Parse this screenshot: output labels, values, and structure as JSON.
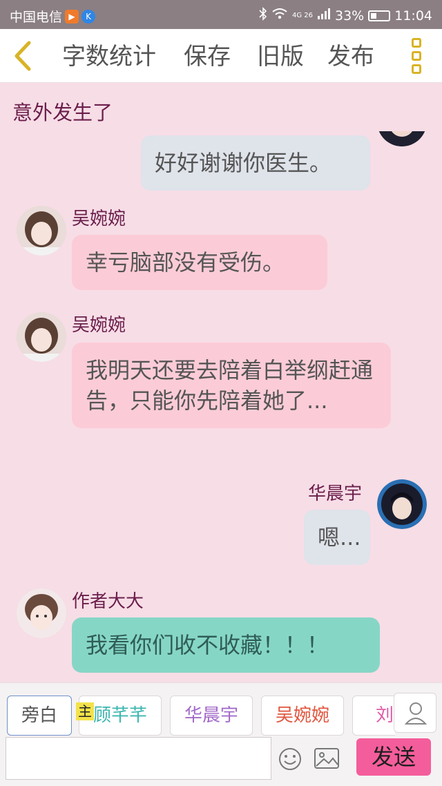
{
  "status_bar": {
    "carrier": "中国电信",
    "network": "4G 26",
    "battery_percent": "33%",
    "battery_level": 0.33,
    "time": "11:04"
  },
  "toolbar": {
    "back_icon": "chevron-left-icon",
    "word_count_label": "字数统计",
    "save_label": "保存",
    "old_version_label": "旧版",
    "publish_label": "发布",
    "more_icon": "more-vertical-icon"
  },
  "chapter": {
    "title": "意外发生了"
  },
  "messages": [
    {
      "sender": "",
      "text": "好好谢谢你医生。",
      "side": "right",
      "style": "grey"
    },
    {
      "sender": "吴婉婉",
      "text": "幸亏脑部没有受伤。",
      "side": "left",
      "style": "pink"
    },
    {
      "sender": "吴婉婉",
      "text": "我明天还要去陪着白举纲赶通告，只能你先陪着她了...",
      "side": "left",
      "style": "pink"
    },
    {
      "sender": "华晨宇",
      "text": "嗯...",
      "side": "right",
      "style": "grey"
    },
    {
      "sender": "作者大大",
      "text": "我看你们收不收藏！！！",
      "side": "left",
      "style": "teal"
    }
  ],
  "characters": {
    "main_tag": "主",
    "chips": [
      {
        "label": "旁白",
        "color": "#555555"
      },
      {
        "label": "顾芊芊",
        "color": "#3bb5b0"
      },
      {
        "label": "华晨宇",
        "color": "#a36bc9"
      },
      {
        "label": "吴婉婉",
        "color": "#e0563f"
      },
      {
        "label": "刘霞",
        "color": "#e05aa8"
      }
    ]
  },
  "composer": {
    "input_value": "",
    "emoji_icon": "smiley-icon",
    "image_icon": "image-icon",
    "send_label": "发送",
    "user_icon": "user-icon"
  },
  "colors": {
    "background": "#f7dde6",
    "name_text": "#6b1e4b",
    "send_button": "#f45d9b",
    "accent_gold": "#d9b326"
  }
}
